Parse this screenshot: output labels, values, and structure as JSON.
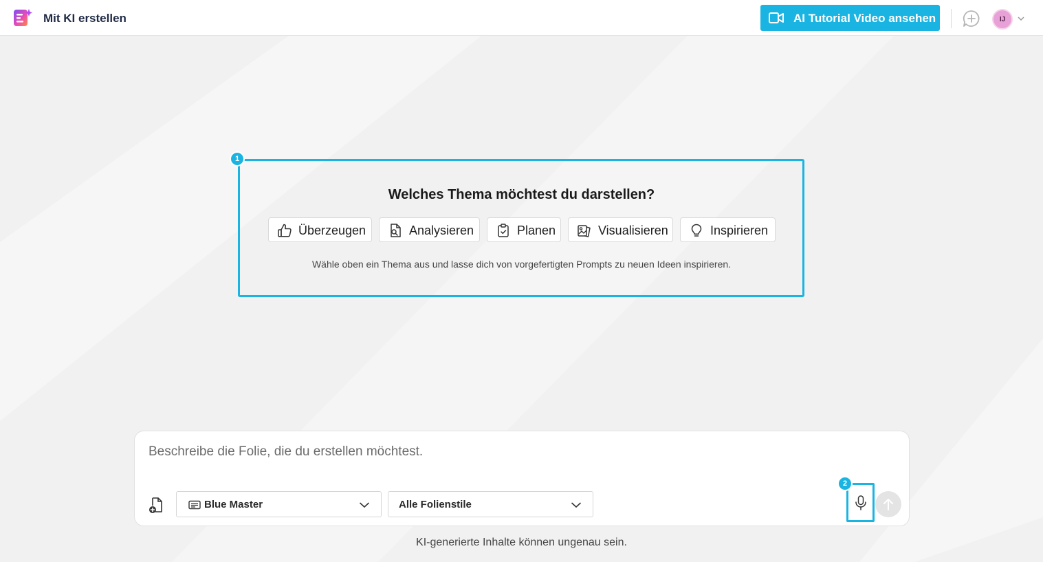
{
  "header": {
    "app_title": "Mit KI erstellen",
    "tutorial_button": "AI Tutorial Video ansehen",
    "avatar_initials": "IJ",
    "logo_icon": "ai-slides-logo-icon",
    "new_chat_icon": "chat-plus-icon"
  },
  "theme_panel": {
    "step_badge": "1",
    "title": "Welches Thema möchtest du darstellen?",
    "chips": [
      {
        "label": "Überzeugen",
        "icon": "thumbs-up-icon"
      },
      {
        "label": "Analysieren",
        "icon": "document-search-icon"
      },
      {
        "label": "Planen",
        "icon": "clipboard-icon"
      },
      {
        "label": "Visualisieren",
        "icon": "image-gallery-icon"
      },
      {
        "label": "Inspirieren",
        "icon": "lightbulb-icon"
      }
    ],
    "hint": "Wähle oben ein Thema aus und lasse dich von vorgefertigten Prompts zu neuen Ideen inspirieren."
  },
  "composer": {
    "input_value": "",
    "placeholder": "Beschreibe die Folie, die du erstellen möchtest.",
    "template_select": "Blue Master",
    "style_select": "Alle Folienstile",
    "mic_badge": "2"
  },
  "disclaimer": "KI-generierte Inhalte können ungenau sein.",
  "colors": {
    "accent": "#1ab4e2",
    "background": "#f1f1f1",
    "avatar": "#e8a1d6"
  }
}
